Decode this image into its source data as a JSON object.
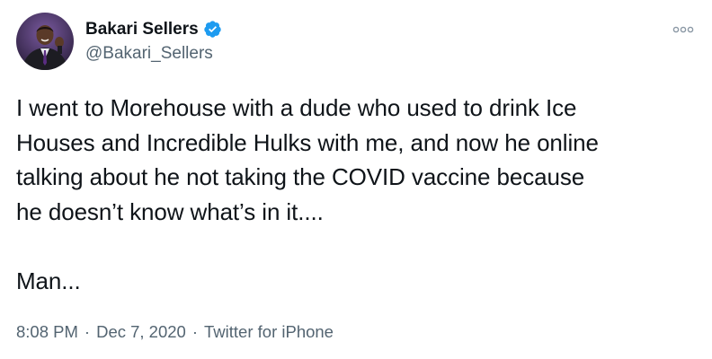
{
  "author": {
    "display_name": "Bakari Sellers",
    "handle": "@Bakari_Sellers",
    "verified": true,
    "verified_icon": "verified-badge-icon",
    "avatar_icon": "profile-photo"
  },
  "menu": {
    "icon": "more-options-icon"
  },
  "tweet": {
    "text": "I went to Morehouse with a dude who used to drink Ice\nHouses and Incredible Hulks with me, and now he online\ntalking about he not taking the COVID vaccine because\nhe doesn’t know what’s in it....\n\nMan..."
  },
  "meta": {
    "time": "8:08 PM",
    "separator1": "·",
    "date": "Dec 7, 2020",
    "separator2": "·",
    "source": "Twitter for iPhone"
  },
  "colors": {
    "text_primary": "#0f1419",
    "text_secondary": "#536471",
    "verified_blue": "#1d9bf0"
  }
}
